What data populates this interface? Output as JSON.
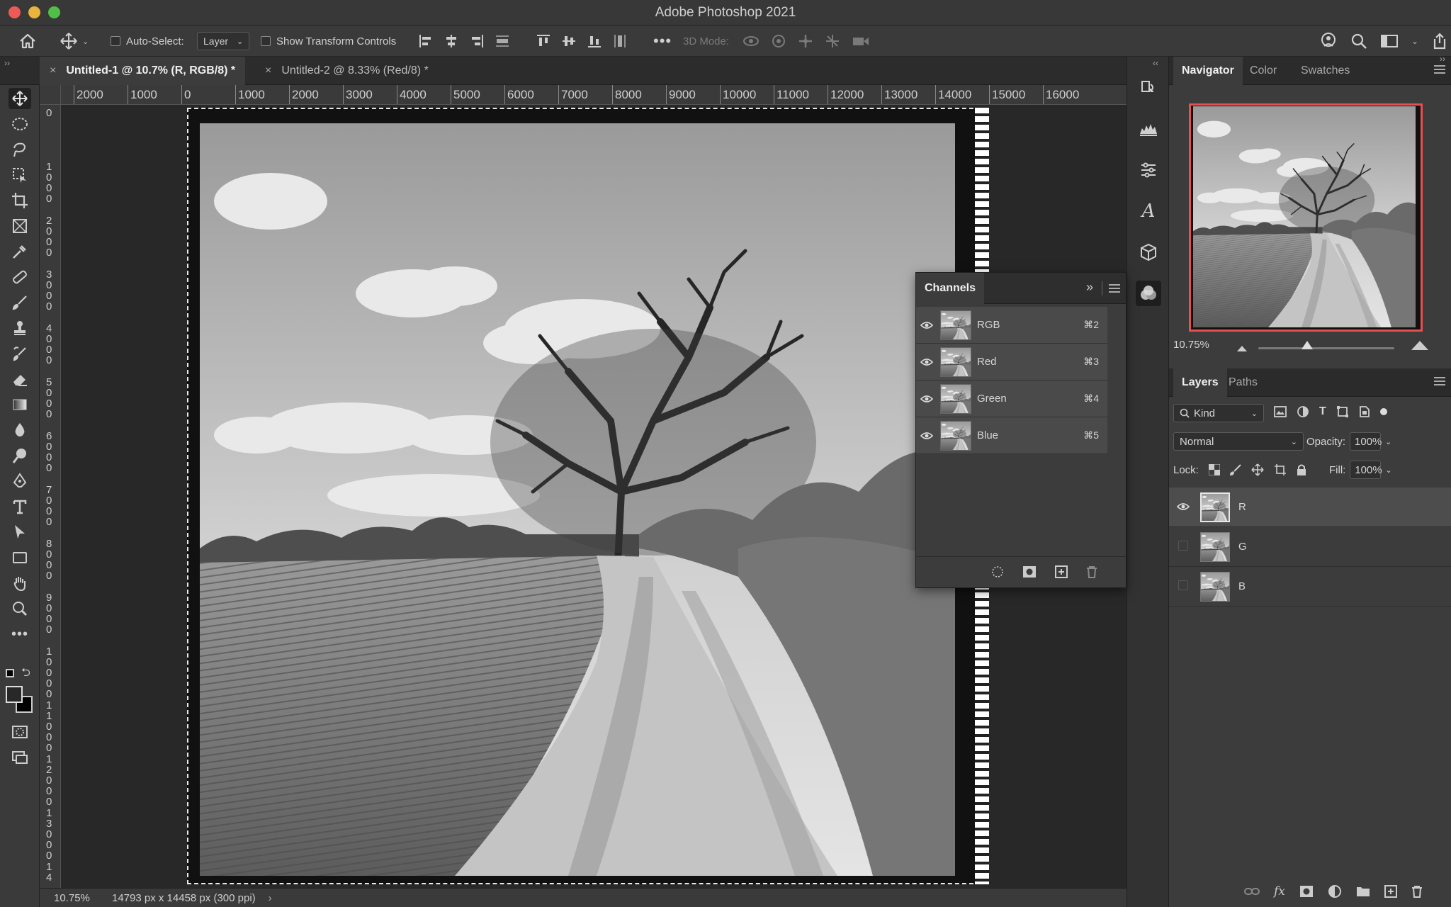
{
  "app": {
    "title": "Adobe Photoshop 2021"
  },
  "options_bar": {
    "auto_select_label": "Auto-Select:",
    "auto_select_value": "Layer",
    "show_transform_label": "Show Transform Controls",
    "mode_3d_label": "3D Mode:"
  },
  "doc_tabs": [
    {
      "label": "Untitled-1 @ 10.7% (R, RGB/8) *",
      "active": true
    },
    {
      "label": "Untitled-2 @ 8.33% (Red/8) *",
      "active": false
    }
  ],
  "ruler_h": [
    "2000",
    "1000",
    "0",
    "1000",
    "2000",
    "3000",
    "4000",
    "5000",
    "6000",
    "7000",
    "8000",
    "9000",
    "10000",
    "11000",
    "12000",
    "13000",
    "14000",
    "15000",
    "16000"
  ],
  "ruler_v": [
    "0",
    "1\n0\n0\n0",
    "2\n0\n0\n0",
    "3\n0\n0\n0",
    "4\n0\n0\n0",
    "5\n0\n0\n0",
    "6\n0\n0\n0",
    "7\n0\n0\n0",
    "8\n0\n0\n0",
    "9\n0\n0\n0",
    "1\n0\n0\n0\n0",
    "1\n1\n0\n0\n0",
    "1\n2\n0\n0\n0",
    "1\n3\n0\n0\n0",
    "1\n4"
  ],
  "status": {
    "zoom": "10.75%",
    "info": "14793 px x 14458 px (300 ppi)"
  },
  "navigator": {
    "tabs": [
      "Navigator",
      "Color",
      "Swatches"
    ],
    "zoom": "10.75%",
    "zoom_level": 0.36
  },
  "layers": {
    "tabs": [
      "Layers",
      "Paths"
    ],
    "kind": "Kind",
    "blend_mode": "Normal",
    "opacity_label": "Opacity:",
    "opacity": "100%",
    "lock_label": "Lock:",
    "fill_label": "Fill:",
    "fill": "100%",
    "items": [
      {
        "name": "R",
        "visible": true,
        "selected": true
      },
      {
        "name": "G",
        "visible": false,
        "selected": false
      },
      {
        "name": "B",
        "visible": false,
        "selected": false
      }
    ]
  },
  "channels": {
    "title": "Channels",
    "items": [
      {
        "name": "RGB",
        "shortcut": "⌘2"
      },
      {
        "name": "Red",
        "shortcut": "⌘3"
      },
      {
        "name": "Green",
        "shortcut": "⌘4"
      },
      {
        "name": "Blue",
        "shortcut": "⌘5"
      }
    ]
  },
  "colors": {
    "accent_nav_frame": "#e8504f",
    "panel_bg": "#3c3c3c",
    "app_bg": "#282828"
  }
}
